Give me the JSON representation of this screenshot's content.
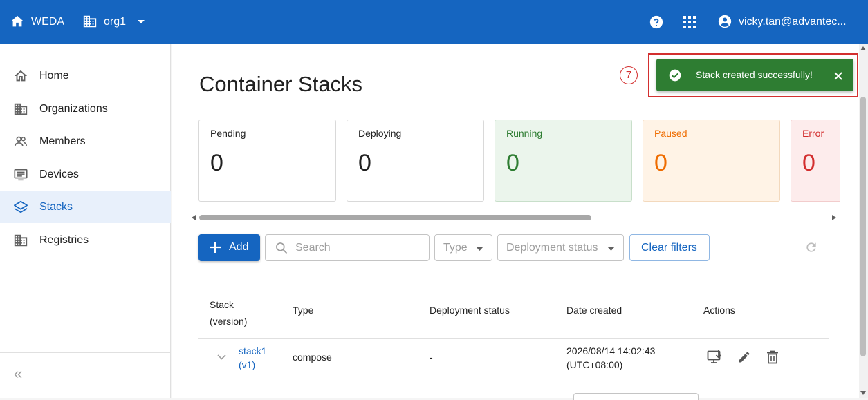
{
  "app": {
    "name": "WEDA",
    "org": "org1",
    "user": "vicky.tan@advantec..."
  },
  "sidebar": {
    "items": [
      {
        "label": "Home",
        "icon": "home-outline-icon"
      },
      {
        "label": "Organizations",
        "icon": "building-icon"
      },
      {
        "label": "Members",
        "icon": "people-icon"
      },
      {
        "label": "Devices",
        "icon": "device-icon"
      },
      {
        "label": "Stacks",
        "icon": "layers-icon",
        "active": true
      },
      {
        "label": "Registries",
        "icon": "building-icon"
      }
    ],
    "collapse_glyph": "«"
  },
  "page": {
    "title": "Container Stacks"
  },
  "status_cards": [
    {
      "label": "Pending",
      "value": "0",
      "color": "#212121",
      "bg": "#ffffff"
    },
    {
      "label": "Deploying",
      "value": "0",
      "color": "#212121",
      "bg": "#ffffff"
    },
    {
      "label": "Running",
      "value": "0",
      "color": "#2e7d32",
      "bg": "#ebf5ec"
    },
    {
      "label": "Paused",
      "value": "0",
      "color": "#ef6c00",
      "bg": "#fff3e6"
    },
    {
      "label": "Error",
      "value": "0",
      "color": "#d32f2f",
      "bg": "#fdecec"
    }
  ],
  "toolbar": {
    "add_label": "Add",
    "search_placeholder": "Search",
    "type_filter": "Type",
    "deployment_status_filter": "Deployment status",
    "clear_filters_label": "Clear filters"
  },
  "table": {
    "headers": {
      "stack_line1": "Stack",
      "stack_line2": "(version)",
      "type": "Type",
      "deployment_status": "Deployment status",
      "date_created": "Date created",
      "actions": "Actions"
    },
    "rows": [
      {
        "name": "stack1",
        "version": "(v1)",
        "type": "compose",
        "deployment_status": "-",
        "date_line1": "2026/08/14 14:02:43",
        "date_line2": "(UTC+08:00)"
      }
    ]
  },
  "toast": {
    "message": "Stack created successfully!",
    "step_marker": "7"
  },
  "colors": {
    "primary": "#1565c0",
    "success": "#2e7d32",
    "highlight_red": "#d32f2f"
  }
}
